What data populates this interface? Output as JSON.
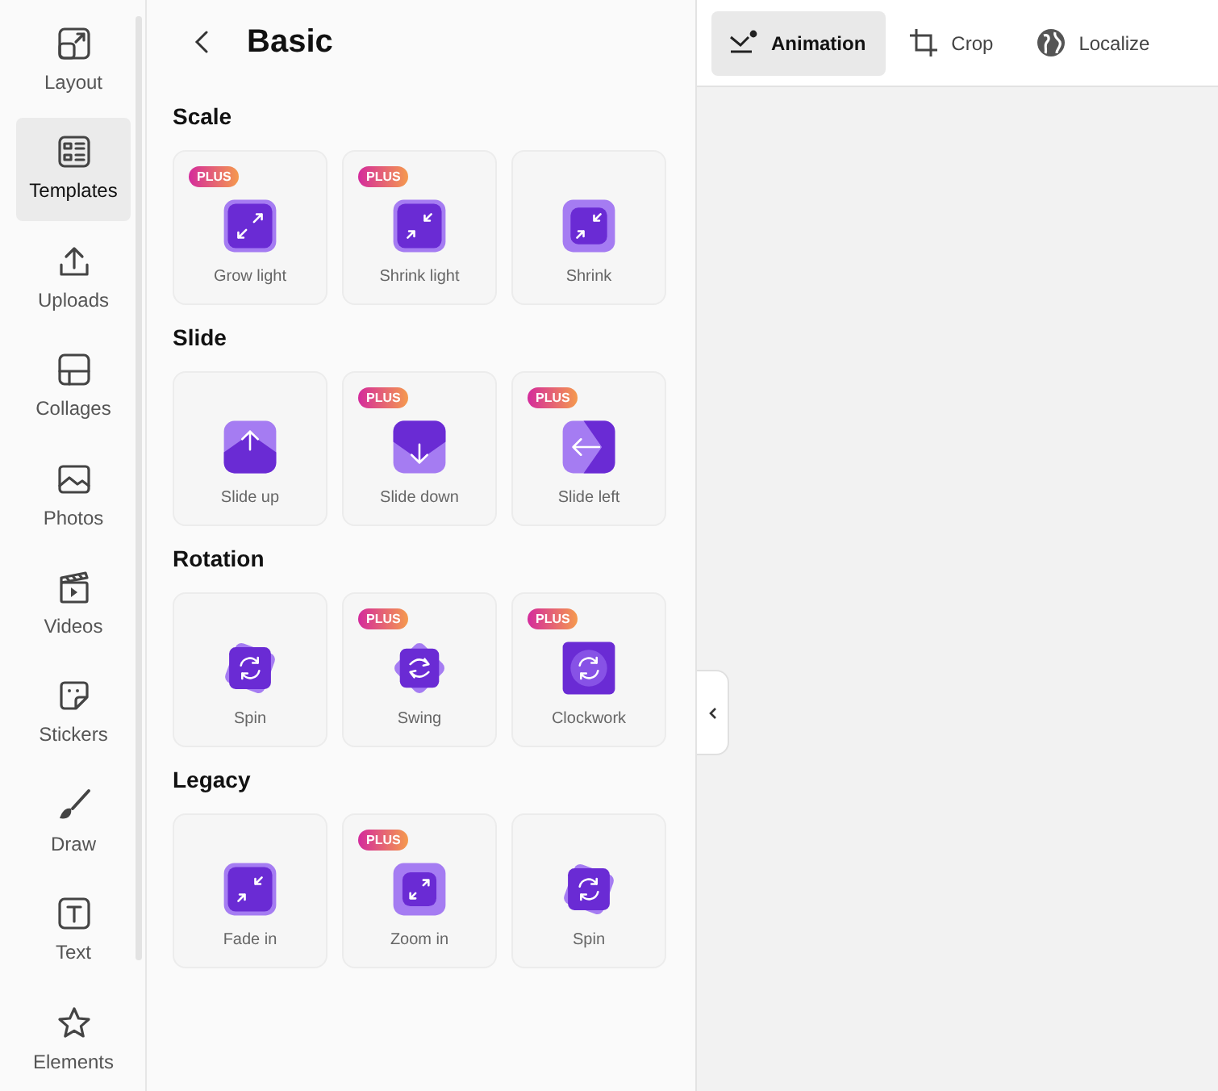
{
  "rail": {
    "items": [
      {
        "label": "Layout",
        "kind": "layout",
        "selected": false
      },
      {
        "label": "Templates",
        "kind": "templates",
        "selected": true
      },
      {
        "label": "Uploads",
        "kind": "upload",
        "selected": false
      },
      {
        "label": "Collages",
        "kind": "collage",
        "selected": false
      },
      {
        "label": "Photos",
        "kind": "image",
        "selected": false
      },
      {
        "label": "Videos",
        "kind": "video",
        "selected": false
      },
      {
        "label": "Stickers",
        "kind": "sticker",
        "selected": false
      },
      {
        "label": "Draw",
        "kind": "brush",
        "selected": false
      },
      {
        "label": "Text",
        "kind": "text",
        "selected": false
      },
      {
        "label": "Elements",
        "kind": "star",
        "selected": false
      }
    ]
  },
  "panel": {
    "title": "Basic",
    "sections": [
      {
        "heading": "Scale",
        "cards": [
          {
            "label": "Grow light",
            "kind": "grow",
            "badge": "PLUS"
          },
          {
            "label": "Shrink light",
            "kind": "shrink",
            "badge": "PLUS"
          },
          {
            "label": "Shrink",
            "kind": "shrink-soft"
          }
        ]
      },
      {
        "heading": "Slide",
        "cards": [
          {
            "label": "Slide up",
            "kind": "slide-up"
          },
          {
            "label": "Slide down",
            "kind": "slide-down",
            "badge": "PLUS"
          },
          {
            "label": "Slide left",
            "kind": "slide-left",
            "badge": "PLUS"
          }
        ]
      },
      {
        "heading": "Rotation",
        "cards": [
          {
            "label": "Spin",
            "kind": "spin"
          },
          {
            "label": "Swing",
            "kind": "swing",
            "badge": "PLUS"
          },
          {
            "label": "Clockwork",
            "kind": "clockwork",
            "badge": "PLUS"
          }
        ]
      },
      {
        "heading": "Legacy",
        "cards": [
          {
            "label": "Fade in",
            "kind": "fade-in"
          },
          {
            "label": "Zoom in",
            "kind": "zoom-in",
            "badge": "PLUS"
          },
          {
            "label": "Spin",
            "kind": "spin"
          }
        ]
      }
    ]
  },
  "toolbar": {
    "tabs": [
      {
        "label": "Animation",
        "kind": "animation",
        "selected": true
      },
      {
        "label": "Crop",
        "kind": "crop",
        "selected": false
      },
      {
        "label": "Localize",
        "kind": "globe",
        "selected": false
      }
    ]
  }
}
